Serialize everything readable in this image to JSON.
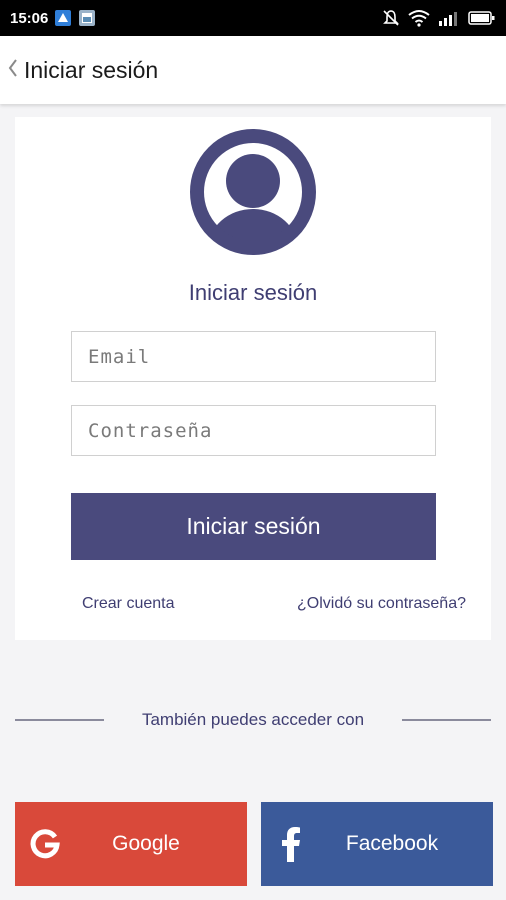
{
  "status_bar": {
    "time": "15:06",
    "icons": [
      "notification-app-icon",
      "notification-gallery-icon",
      "silent-icon",
      "wifi-icon",
      "signal-icon",
      "battery-icon"
    ]
  },
  "header": {
    "title": "Iniciar sesión",
    "back_icon": "chevron-left-icon"
  },
  "card": {
    "avatar_icon": "user-avatar-icon",
    "title": "Iniciar sesión",
    "email_placeholder": "Email",
    "password_placeholder": "Contraseña",
    "login_button": "Iniciar sesión",
    "create_account": "Crear cuenta",
    "forgot_password": "¿Olvidó su contraseña?"
  },
  "divider_text": "También puedes acceder con",
  "social": {
    "google": {
      "label": "Google",
      "icon": "google-g-icon",
      "color": "#d9493a"
    },
    "facebook": {
      "label": "Facebook",
      "icon": "facebook-f-icon",
      "color": "#3b5a9a"
    }
  },
  "colors": {
    "accent": "#4a4a7d",
    "text_accent": "#3f3e72",
    "background": "#f4f4f6"
  }
}
